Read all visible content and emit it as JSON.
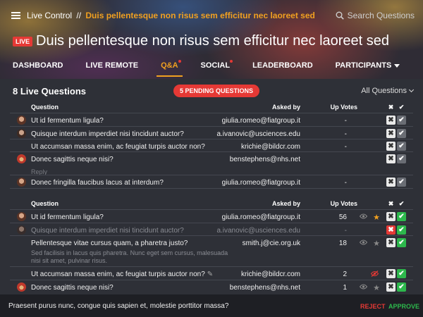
{
  "header": {
    "breadcrumb_root": "Live Control",
    "breadcrumb_sep": "//",
    "breadcrumb_current": "Duis pellentesque non risus sem efficitur nec laoreet sed",
    "search_placeholder": "Search Questions",
    "live_badge": "LIVE",
    "title": "Duis pellentesque non risus sem efficitur nec laoreet sed"
  },
  "tabs": [
    {
      "label": "DASHBOARD"
    },
    {
      "label": "LIVE REMOTE"
    },
    {
      "label": "Q&A"
    },
    {
      "label": "SOCIAL"
    },
    {
      "label": "LEADERBOARD"
    },
    {
      "label": "PARTICIPANTS"
    }
  ],
  "questions": {
    "count_label": "8 Live Questions",
    "pending_label": "5 PENDING QUESTIONS",
    "filter_label": "All Questions",
    "columns": {
      "question": "Question",
      "asked_by": "Asked by",
      "votes": "Up Votes"
    }
  },
  "pending_rows": [
    {
      "text": "Ut id fermentum ligula?",
      "by": "giulia.romeo@fiatgroup.it",
      "votes": "-"
    },
    {
      "text": "Quisque interdum imperdiet nisi tincidunt auctor?",
      "by": "a.ivanovic@usciences.edu",
      "votes": "-"
    },
    {
      "text": "Ut accumsan massa enim, ac feugiat turpis auctor non?",
      "by": "krichie@bildcr.com",
      "votes": "-"
    },
    {
      "text": "Donec sagittis neque nisi?",
      "by": "benstephens@nhs.net",
      "votes": "",
      "reply": "Reply"
    },
    {
      "text": "Donec fringilla faucibus lacus at interdum?",
      "by": "giulia.romeo@fiatgroup.it",
      "votes": "-"
    }
  ],
  "live_rows": [
    {
      "text": "Ut id fermentum ligula?",
      "by": "giulia.romeo@fiatgroup.it",
      "votes": "56"
    },
    {
      "text": "Quisque interdum imperdiet nisi tincidunt auctor?",
      "by": "a.ivanovic@usciences.edu",
      "votes": "-"
    },
    {
      "text": "Pellentesque vitae cursus quam, a pharetra justo?",
      "by": "smith.j@cie.org.uk",
      "votes": "18",
      "sub": "Sed facilisis in lacus quis pharetra. Nunc eget sem cursus, malesuada nisi sit amet, pulvinar risus."
    },
    {
      "text": "Ut accumsan massa enim, ac feugiat turpis auctor non?",
      "by": "krichie@bildcr.com",
      "votes": "2"
    },
    {
      "text": "Donec sagittis neque nisi?",
      "by": "benstephens@nhs.net",
      "votes": "1"
    }
  ],
  "bottom": {
    "message": "Praesent purus nunc, congue quis sapien et, molestie porttitor massa?",
    "reject": "REJECT",
    "approve": "APPROVE"
  },
  "colors": {
    "accent": "#f0a020",
    "live": "#e53935",
    "approve": "#2db84c"
  }
}
